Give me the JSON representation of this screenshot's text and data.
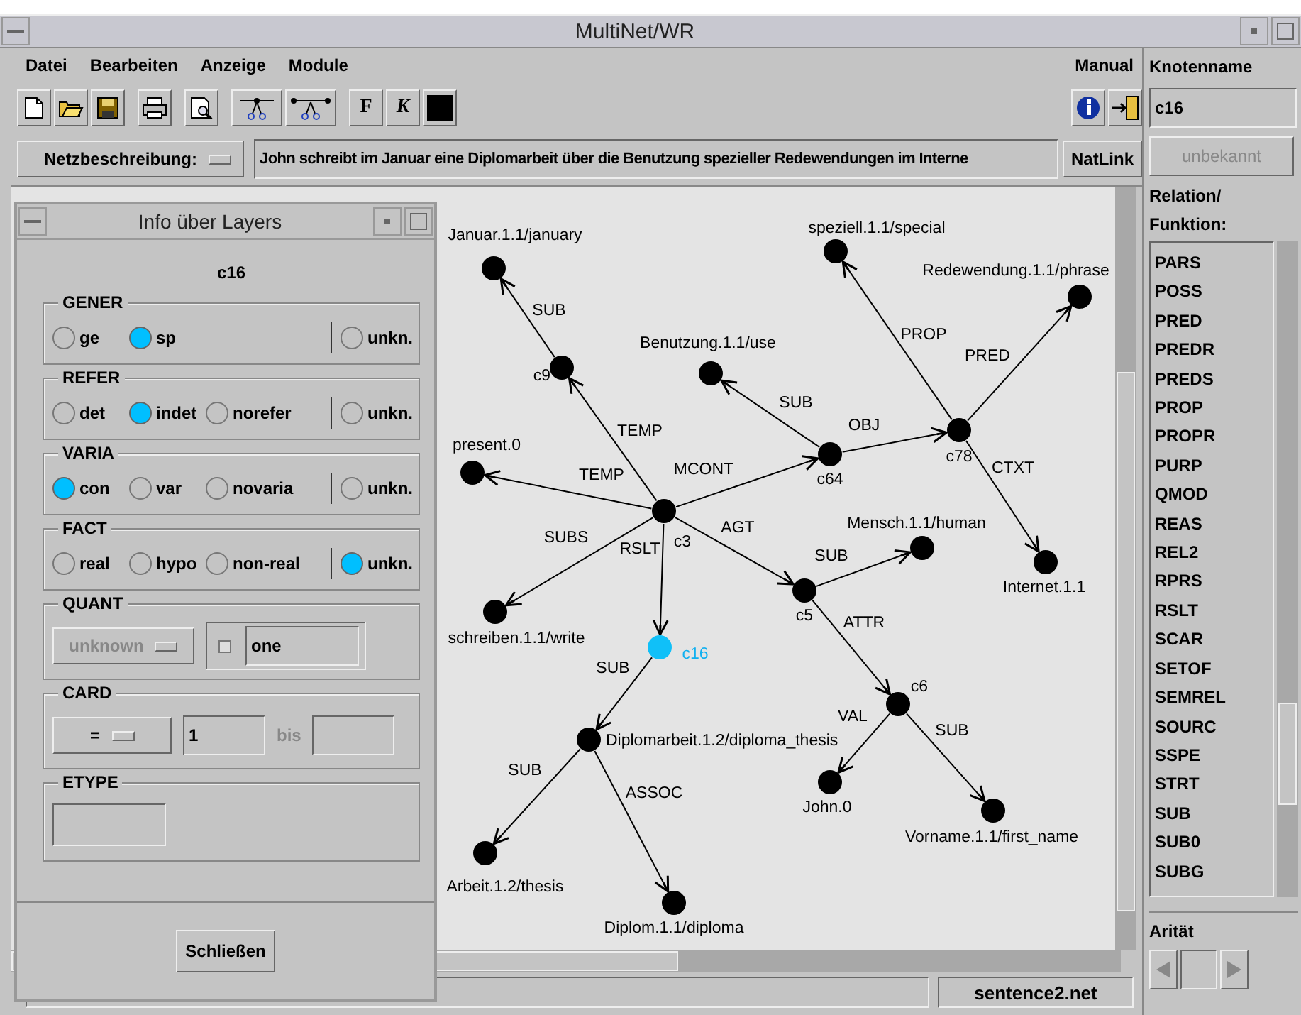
{
  "window": {
    "title": "MultiNet/WR"
  },
  "menu": [
    "Datei",
    "Bearbeiten",
    "Anzeige",
    "Module"
  ],
  "help_menu": "Manual",
  "toolbar": {
    "text_buttons": [
      "F",
      "K"
    ]
  },
  "sentence_bar": {
    "mode_button": "Netzbeschreibung:",
    "sentence": "John schreibt im Januar eine Diplomarbeit über die Benutzung spezieller Redewendungen im Interne",
    "natlink_button": "NatLink"
  },
  "graph": {
    "nodes": [
      {
        "label": "speziell.1.1/special",
        "selected": false
      },
      {
        "label": "Januar.1.1/january",
        "selected": false
      },
      {
        "label": "Redewendung.1.1/phrase",
        "selected": false
      },
      {
        "label": "Benutzung.1.1/use",
        "selected": false
      },
      {
        "label": "c9",
        "selected": false
      },
      {
        "label": "c78",
        "selected": false
      },
      {
        "label": "present.0",
        "selected": false
      },
      {
        "label": "c64",
        "selected": false
      },
      {
        "label": "c3",
        "selected": false
      },
      {
        "label": "Mensch.1.1/human",
        "selected": false
      },
      {
        "label": "Internet.1.1",
        "selected": false
      },
      {
        "label": "c5",
        "selected": false
      },
      {
        "label": "schreiben.1.1/write",
        "selected": false
      },
      {
        "label": "c16",
        "selected": true
      },
      {
        "label": "c6",
        "selected": false
      },
      {
        "label": "Diplomarbeit.1.2/diploma_thesis",
        "selected": false
      },
      {
        "label": "John.0",
        "selected": false
      },
      {
        "label": "Vorname.1.1/first_name",
        "selected": false
      },
      {
        "label": "Arbeit.1.2/thesis",
        "selected": false
      },
      {
        "label": "Diplom.1.1/diploma",
        "selected": false
      }
    ],
    "edges": [
      {
        "label": "SUB"
      },
      {
        "label": "PROP"
      },
      {
        "label": "PRED"
      },
      {
        "label": "SUB"
      },
      {
        "label": "OBJ"
      },
      {
        "label": "TEMP"
      },
      {
        "label": "MCONT"
      },
      {
        "label": "CTXT"
      },
      {
        "label": "TEMP"
      },
      {
        "label": "AGT"
      },
      {
        "label": "SUBS"
      },
      {
        "label": "RSLT"
      },
      {
        "label": "SUB"
      },
      {
        "label": "ATTR"
      },
      {
        "label": "SUB"
      },
      {
        "label": "VAL"
      },
      {
        "label": "SUB"
      },
      {
        "label": "SUB"
      },
      {
        "label": "ASSOC"
      }
    ]
  },
  "status_bar": {
    "file": "sentence2.net"
  },
  "layer_dialog": {
    "title": "Info über Layers",
    "node": "c16",
    "layers": [
      {
        "name": "GENER",
        "options": [
          {
            "label": "ge",
            "selected": false
          },
          {
            "label": "sp",
            "selected": true
          }
        ],
        "unknown": {
          "label": "unkn.",
          "selected": false
        }
      },
      {
        "name": "REFER",
        "options": [
          {
            "label": "det",
            "selected": false
          },
          {
            "label": "indet",
            "selected": true
          },
          {
            "label": "norefer",
            "selected": false
          }
        ],
        "unknown": {
          "label": "unkn.",
          "selected": false
        }
      },
      {
        "name": "VARIA",
        "options": [
          {
            "label": "con",
            "selected": true
          },
          {
            "label": "var",
            "selected": false
          },
          {
            "label": "novaria",
            "selected": false
          }
        ],
        "unknown": {
          "label": "unkn.",
          "selected": false
        }
      },
      {
        "name": "FACT",
        "options": [
          {
            "label": "real",
            "selected": false
          },
          {
            "label": "hypo",
            "selected": false
          },
          {
            "label": "non-real",
            "selected": false
          }
        ],
        "unknown": {
          "label": "unkn.",
          "selected": true
        }
      }
    ],
    "quant": {
      "name": "QUANT",
      "dropdown": {
        "label": "unknown",
        "disabled": true
      },
      "checked": false,
      "value": "one"
    },
    "card": {
      "name": "CARD",
      "dropdown": {
        "label": "=",
        "disabled": false
      },
      "from": "1",
      "to_label": "bis"
    },
    "etype": {
      "name": "ETYPE"
    },
    "close_button": "Schließen"
  },
  "node_panel": {
    "label": "Knotenname",
    "value": "c16",
    "status_button": {
      "label": "unbekannt",
      "disabled": true
    },
    "relation_heading": [
      "Relation/",
      "Funktion:"
    ],
    "relations": [
      "PARS",
      "POSS",
      "PRED",
      "PREDR",
      "PREDS",
      "PROP",
      "PROPR",
      "PURP",
      "QMOD",
      "REAS",
      "REL2",
      "RPRS",
      "RSLT",
      "SCAR",
      "SETOF",
      "SEMREL",
      "SOURC",
      "SSPE",
      "STRT",
      "SUB",
      "SUB0",
      "SUBG"
    ],
    "arity_label": "Arität"
  }
}
